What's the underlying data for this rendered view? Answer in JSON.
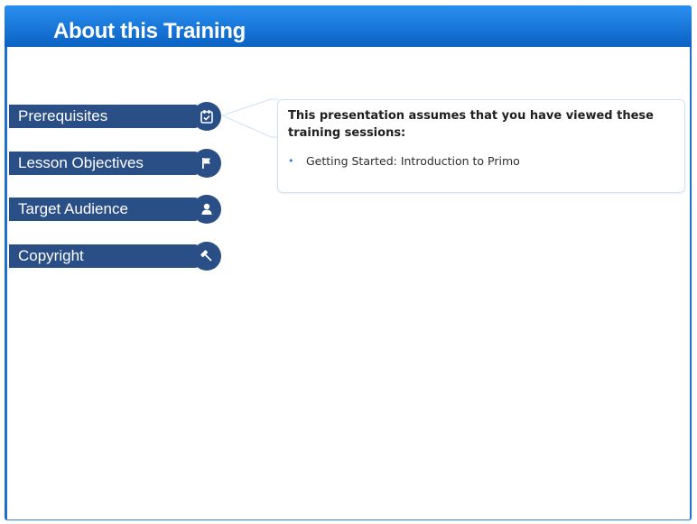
{
  "header": {
    "title": "About this Training"
  },
  "tabs": [
    {
      "label": "Prerequisites",
      "icon": "checklist-clipboard"
    },
    {
      "label": "Lesson Objectives",
      "icon": "flag"
    },
    {
      "label": "Target Audience",
      "icon": "person"
    },
    {
      "label": "Copyright",
      "icon": "gavel"
    }
  ],
  "callout": {
    "heading": "This presentation assumes that you have viewed these training sessions:",
    "items": [
      {
        "bullet": "•",
        "text": "Getting Started: Introduction to Primo"
      }
    ]
  },
  "colors": {
    "header_gradient_top": "#2a8ff0",
    "header_gradient_bottom": "#0a62c4",
    "tab_background": "#2a4e86",
    "callout_border": "#cfe2f4",
    "bullet": "#2a7fd4"
  }
}
